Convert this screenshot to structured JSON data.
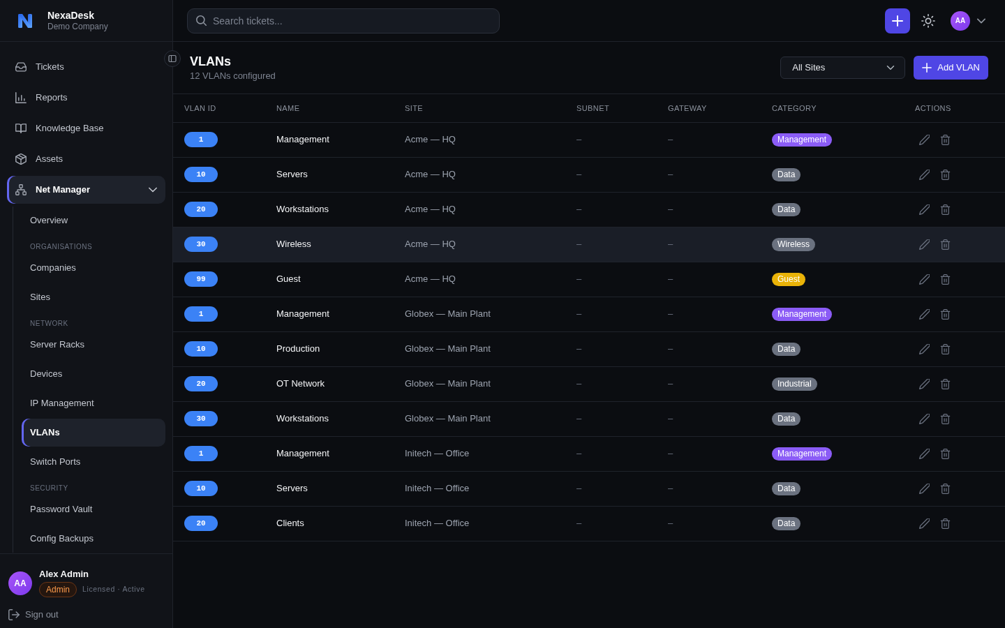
{
  "sidebar": {
    "brand": {
      "name": "NexaDesk",
      "company": "Demo Company"
    },
    "nav": [
      {
        "kind": "link",
        "label": "Tickets",
        "selected": false
      },
      {
        "kind": "link",
        "label": "Reports",
        "selected": false
      },
      {
        "kind": "link",
        "label": "Knowledge Base",
        "selected": false
      },
      {
        "kind": "link",
        "label": "Assets",
        "selected": false
      },
      {
        "kind": "group",
        "label": "Net Manager",
        "selected": true,
        "expanded": true,
        "children": [
          {
            "kind": "link",
            "label": "Overview",
            "selected": false
          },
          {
            "kind": "heading",
            "label": "ORGANISATIONS"
          },
          {
            "kind": "link",
            "label": "Companies",
            "selected": false
          },
          {
            "kind": "link",
            "label": "Sites",
            "selected": false
          },
          {
            "kind": "heading",
            "label": "NETWORK"
          },
          {
            "kind": "link",
            "label": "Server Racks",
            "selected": false
          },
          {
            "kind": "link",
            "label": "Devices",
            "selected": false
          },
          {
            "kind": "link",
            "label": "IP Management",
            "selected": false
          },
          {
            "kind": "link",
            "label": "VLANs",
            "selected": true
          },
          {
            "kind": "link",
            "label": "Switch Ports",
            "selected": false
          },
          {
            "kind": "heading",
            "label": "SECURITY"
          },
          {
            "kind": "link",
            "label": "Password Vault",
            "selected": false
          },
          {
            "kind": "link",
            "label": "Config Backups",
            "selected": false
          }
        ]
      }
    ],
    "user": {
      "initials": "AA",
      "name": "Alex Admin",
      "role": "Admin",
      "status": "Licensed · Active"
    },
    "sign_out": "Sign out"
  },
  "topbar": {
    "search": {
      "placeholder": "Search tickets..."
    },
    "avatar_initials": "AA"
  },
  "page": {
    "title": "VLANs",
    "subtitle": "12 VLANs configured",
    "site_filter": "All Sites",
    "add_button": "Add VLAN"
  },
  "table": {
    "columns": [
      "VLAN ID",
      "NAME",
      "SITE",
      "SUBNET",
      "GATEWAY",
      "CATEGORY",
      "ACTIONS"
    ],
    "rows": [
      {
        "vlan_id": "1",
        "name": "Management",
        "site": "Acme — HQ",
        "subnet": "–",
        "gateway": "–",
        "category": {
          "label": "Management",
          "color": "#8b5cf6"
        },
        "selected": false
      },
      {
        "vlan_id": "10",
        "name": "Servers",
        "site": "Acme — HQ",
        "subnet": "–",
        "gateway": "–",
        "category": {
          "label": "Data",
          "color": "#6b7280"
        },
        "selected": false
      },
      {
        "vlan_id": "20",
        "name": "Workstations",
        "site": "Acme — HQ",
        "subnet": "–",
        "gateway": "–",
        "category": {
          "label": "Data",
          "color": "#6b7280"
        },
        "selected": false
      },
      {
        "vlan_id": "30",
        "name": "Wireless",
        "site": "Acme — HQ",
        "subnet": "–",
        "gateway": "–",
        "category": {
          "label": "Wireless",
          "color": "#6b7280"
        },
        "selected": true
      },
      {
        "vlan_id": "99",
        "name": "Guest",
        "site": "Acme — HQ",
        "subnet": "–",
        "gateway": "–",
        "category": {
          "label": "Guest",
          "color": "#eab308"
        },
        "selected": false
      },
      {
        "vlan_id": "1",
        "name": "Management",
        "site": "Globex — Main Plant",
        "subnet": "–",
        "gateway": "–",
        "category": {
          "label": "Management",
          "color": "#8b5cf6"
        },
        "selected": false
      },
      {
        "vlan_id": "10",
        "name": "Production",
        "site": "Globex — Main Plant",
        "subnet": "–",
        "gateway": "–",
        "category": {
          "label": "Data",
          "color": "#6b7280"
        },
        "selected": false
      },
      {
        "vlan_id": "20",
        "name": "OT Network",
        "site": "Globex — Main Plant",
        "subnet": "–",
        "gateway": "–",
        "category": {
          "label": "Industrial",
          "color": "#6b7280"
        },
        "selected": false
      },
      {
        "vlan_id": "30",
        "name": "Workstations",
        "site": "Globex — Main Plant",
        "subnet": "–",
        "gateway": "–",
        "category": {
          "label": "Data",
          "color": "#6b7280"
        },
        "selected": false
      },
      {
        "vlan_id": "1",
        "name": "Management",
        "site": "Initech — Office",
        "subnet": "–",
        "gateway": "–",
        "category": {
          "label": "Management",
          "color": "#8b5cf6"
        },
        "selected": false
      },
      {
        "vlan_id": "10",
        "name": "Servers",
        "site": "Initech — Office",
        "subnet": "–",
        "gateway": "–",
        "category": {
          "label": "Data",
          "color": "#6b7280"
        },
        "selected": false
      },
      {
        "vlan_id": "20",
        "name": "Clients",
        "site": "Initech — Office",
        "subnet": "–",
        "gateway": "–",
        "category": {
          "label": "Data",
          "color": "#6b7280"
        },
        "selected": false
      }
    ]
  }
}
